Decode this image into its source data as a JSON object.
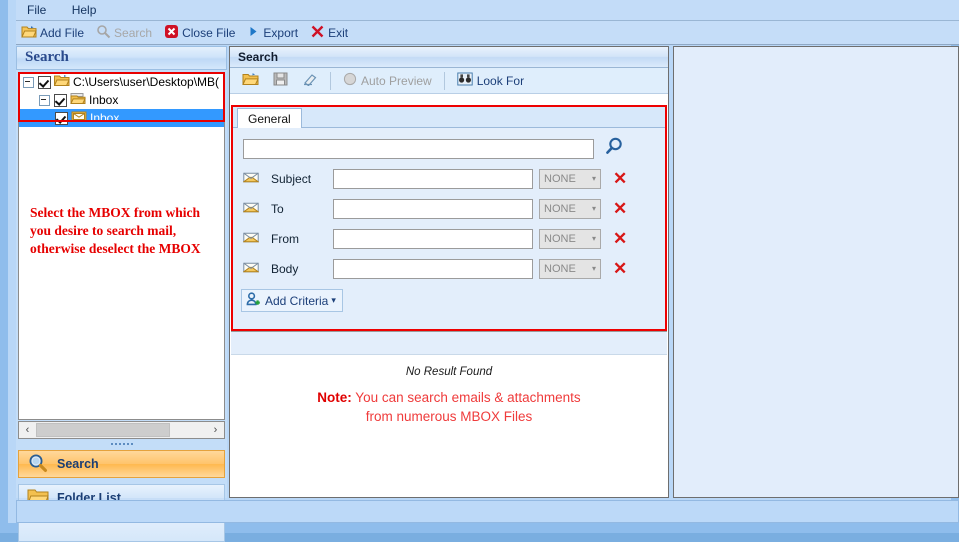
{
  "menu": {
    "items": [
      {
        "label": "File",
        "name": "menu-file"
      },
      {
        "label": "Help",
        "name": "menu-help"
      }
    ]
  },
  "toolbar": {
    "items": [
      {
        "label": "Add File",
        "icon": "open-folder-icon",
        "disabled": false
      },
      {
        "label": "Search",
        "icon": "magnifier-icon",
        "disabled": true
      },
      {
        "label": "Close File",
        "icon": "close-x-icon",
        "disabled": false
      },
      {
        "label": "Export",
        "icon": "play-triangle-icon",
        "disabled": false
      },
      {
        "label": "Exit",
        "icon": "exit-x-icon",
        "disabled": false
      }
    ]
  },
  "left_panel": {
    "header": "Search",
    "tree": {
      "nodes": [
        {
          "label": "C:\\Users\\user\\Desktop\\MB(",
          "level": 1,
          "checked": true,
          "expanded": true,
          "icon": "folder-open-icon",
          "selected": false
        },
        {
          "label": "Inbox",
          "level": 2,
          "checked": true,
          "expanded": true,
          "icon": "folder-stack-icon",
          "selected": false
        },
        {
          "label": "Inbox",
          "level": 3,
          "checked": true,
          "expanded": false,
          "icon": "mail-folder-icon",
          "selected": true
        }
      ]
    },
    "annotation": "Select the MBOX from which you desire to search mail, otherwise deselect the MBOX",
    "scrollbar": {
      "left_arrow": "‹",
      "right_arrow": "›"
    },
    "nav_buttons": [
      {
        "label": "Search",
        "icon": "magnifier-icon",
        "active": true
      },
      {
        "label": "Folder List",
        "icon": "folder-icon",
        "active": false
      }
    ]
  },
  "center_panel": {
    "header": "Search",
    "toolbar": [
      {
        "label": "",
        "icon": "open-folder-icon",
        "disabled": false
      },
      {
        "label": "",
        "icon": "save-disk-icon",
        "disabled": true
      },
      {
        "label": "",
        "icon": "eraser-icon",
        "disabled": false
      },
      {
        "label": "Auto Preview",
        "icon": "radio-circle-icon",
        "disabled": true
      },
      {
        "label": "Look For",
        "icon": "binoculars-icon",
        "disabled": false
      }
    ],
    "tabs": [
      {
        "label": "General",
        "active": true
      }
    ],
    "search_box": {
      "value": "",
      "placeholder": ""
    },
    "magnifier_icon": "magnifier-icon",
    "criteria_rows": [
      {
        "label": "Subject",
        "value": "",
        "condition": "NONE",
        "icon": "envelope-icon"
      },
      {
        "label": "To",
        "value": "",
        "condition": "NONE",
        "icon": "envelope-icon"
      },
      {
        "label": "From",
        "value": "",
        "condition": "NONE",
        "icon": "envelope-icon"
      },
      {
        "label": "Body",
        "value": "",
        "condition": "NONE",
        "icon": "envelope-icon"
      }
    ],
    "add_criteria": {
      "label": "Add Criteria",
      "icon": "add-person-icon",
      "caret": "▾"
    },
    "result": {
      "no_result": "No Result Found",
      "note_prefix": "Note:",
      "note_line1": " You can search emails & attachments",
      "note_line2": "from numerous MBOX Files"
    }
  },
  "colors": {
    "window_frame": "#8fbdec",
    "panel_bg": "#c3ddf8",
    "accent_red": "#ee0000",
    "link_blue": "#1c3f79",
    "selection_blue": "#3399ff",
    "active_nav": "#ffc46b"
  }
}
